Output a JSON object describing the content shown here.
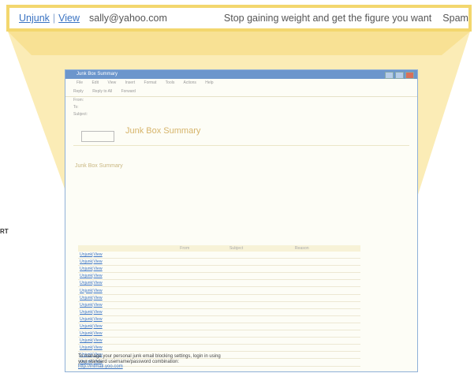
{
  "zoom_row": {
    "unjunk": "Unjunk",
    "separator": "|",
    "view": "View",
    "email": "sally@yahoo.com",
    "subject": "Stop gaining weight and get the figure you want",
    "reason": "Spam"
  },
  "side_label": "RT",
  "window": {
    "title": "Junk Box Summary",
    "menu": [
      "File",
      "Edit",
      "View",
      "Insert",
      "Format",
      "Tools",
      "Actions",
      "Help"
    ],
    "toolbar": [
      "Reply",
      "Reply to All",
      "Forward"
    ],
    "from_label": "From:",
    "to_label": "To:",
    "subject_label": "Subject:",
    "from_value": "",
    "to_value": "",
    "subject_value": "",
    "date_value": "",
    "banner_title": "Junk Box Summary",
    "banner_sub": "",
    "logo_text": "",
    "intro": "",
    "section_title": "Junk Box Summary",
    "columns": [
      "",
      "From",
      "Subject",
      "Reason"
    ],
    "rows": [
      {
        "unjunk": "Unjunk",
        "view": "View",
        "from": "",
        "subject": "",
        "reason": ""
      },
      {
        "unjunk": "Unjunk",
        "view": "View",
        "from": "",
        "subject": "",
        "reason": ""
      },
      {
        "unjunk": "Unjunk",
        "view": "View",
        "from": "",
        "subject": "",
        "reason": ""
      },
      {
        "unjunk": "Unjunk",
        "view": "View",
        "from": "",
        "subject": "",
        "reason": ""
      },
      {
        "unjunk": "Unjunk",
        "view": "View",
        "from": "",
        "subject": "",
        "reason": ""
      },
      {
        "unjunk": "Unjunk",
        "view": "View",
        "from": "",
        "subject": "",
        "reason": ""
      },
      {
        "unjunk": "Unjunk",
        "view": "View",
        "from": "",
        "subject": "",
        "reason": ""
      },
      {
        "unjunk": "Unjunk",
        "view": "View",
        "from": "",
        "subject": "",
        "reason": ""
      },
      {
        "unjunk": "Unjunk",
        "view": "View",
        "from": "",
        "subject": "",
        "reason": ""
      },
      {
        "unjunk": "Unjunk",
        "view": "View",
        "from": "",
        "subject": "",
        "reason": ""
      },
      {
        "unjunk": "Unjunk",
        "view": "View",
        "from": "",
        "subject": "",
        "reason": ""
      },
      {
        "unjunk": "Unjunk",
        "view": "View",
        "from": "",
        "subject": "",
        "reason": ""
      },
      {
        "unjunk": "Unjunk",
        "view": "View",
        "from": "",
        "subject": "",
        "reason": ""
      },
      {
        "unjunk": "Unjunk",
        "view": "View",
        "from": "",
        "subject": "",
        "reason": ""
      },
      {
        "unjunk": "Unjunk",
        "view": "View",
        "from": "",
        "subject": "",
        "reason": ""
      },
      {
        "unjunk": "Unjunk",
        "view": "View",
        "from": "",
        "subject": "",
        "reason": ""
      }
    ],
    "footer_line1": "To manage your personal junk email blocking settings, login in using",
    "footer_line2": "your standard username/password combination:",
    "footer_link": "http://intmail.yoo.com"
  },
  "colors": {
    "highlight": "#f3d76e",
    "link": "#3a73c2"
  }
}
